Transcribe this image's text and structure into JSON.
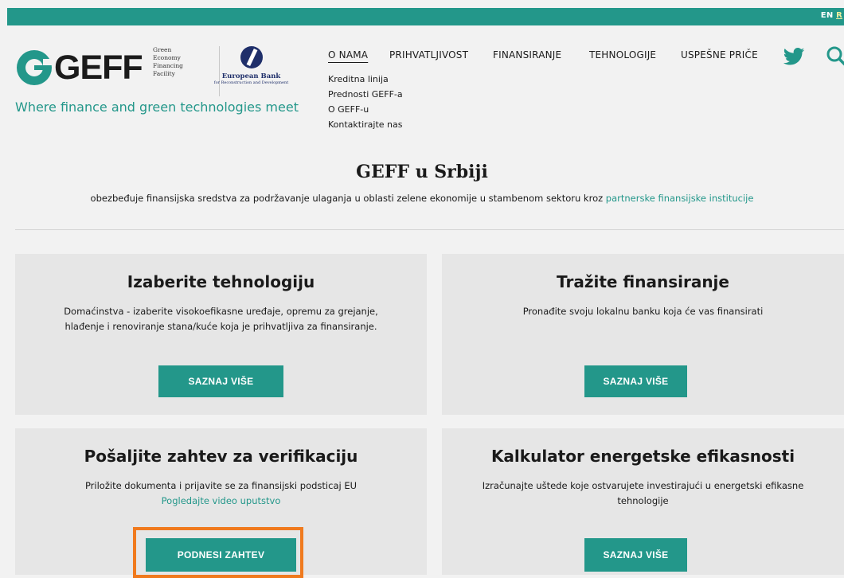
{
  "topbar": {
    "lang_en": "EN",
    "lang_rs": "R"
  },
  "logo": {
    "word": "GEFF",
    "small_lines": [
      "Green",
      "Economy",
      "Financing",
      "Facility"
    ],
    "ebrd_name": "European Bank",
    "ebrd_sub": "for Reconstruction and Development"
  },
  "tagline": "Where finance and green technologies meet",
  "nav": {
    "items": [
      "O NAMA",
      "PRIHVATLJIVOST",
      "FINANSIRANJE",
      "TEHNOLOGIJE",
      "USPEŠNE PRIČE"
    ],
    "sub_items": [
      "Kreditna linija",
      "Prednosti GEFF-a",
      "O GEFF-u",
      "Kontaktirajte nas"
    ]
  },
  "hero": {
    "title": "GEFF u Srbiji",
    "subtitle": "obezbeđuje finansijska sredstva za podržavanje ulaganja u oblasti zelene ekonomije u stambenom sektoru kroz ",
    "subtitle_link": "partnerske finansijske institucije"
  },
  "cards": [
    {
      "title": "Izaberite tehnologiju",
      "text_1": "Domaćinstva - izaberite visokoefikasne uređaje, opremu za grejanje,",
      "text_2": "hlađenje i renoviranje stana/kuće koja je prihvatljiva za finansiranje.",
      "button": "SAZNAJ VIŠE"
    },
    {
      "title": "Tražite finansiranje",
      "text_1": "Pronađite svoju lokalnu banku koja će vas finansirati",
      "button": "SAZNAJ VIŠE"
    },
    {
      "title": "Pošaljite zahtev za verifikaciju",
      "text_1": "Priložite dokumenta i prijavite se za finansijski podsticaj EU",
      "link": "Pogledajte video uputstvo",
      "button": "PODNESI ZAHTEV"
    },
    {
      "title": "Kalkulator energetske efikasnosti",
      "text_1": "Izračunajte uštede koje ostvarujete investirajući u energetski efikasne",
      "text_2": "tehnologije",
      "button": "SAZNAJ VIŠE"
    }
  ],
  "colors": {
    "brand": "#23978a",
    "highlight": "#f07a1e",
    "ebrd": "#1f2f6a"
  },
  "icons": [
    "twitter-icon",
    "search-icon"
  ]
}
